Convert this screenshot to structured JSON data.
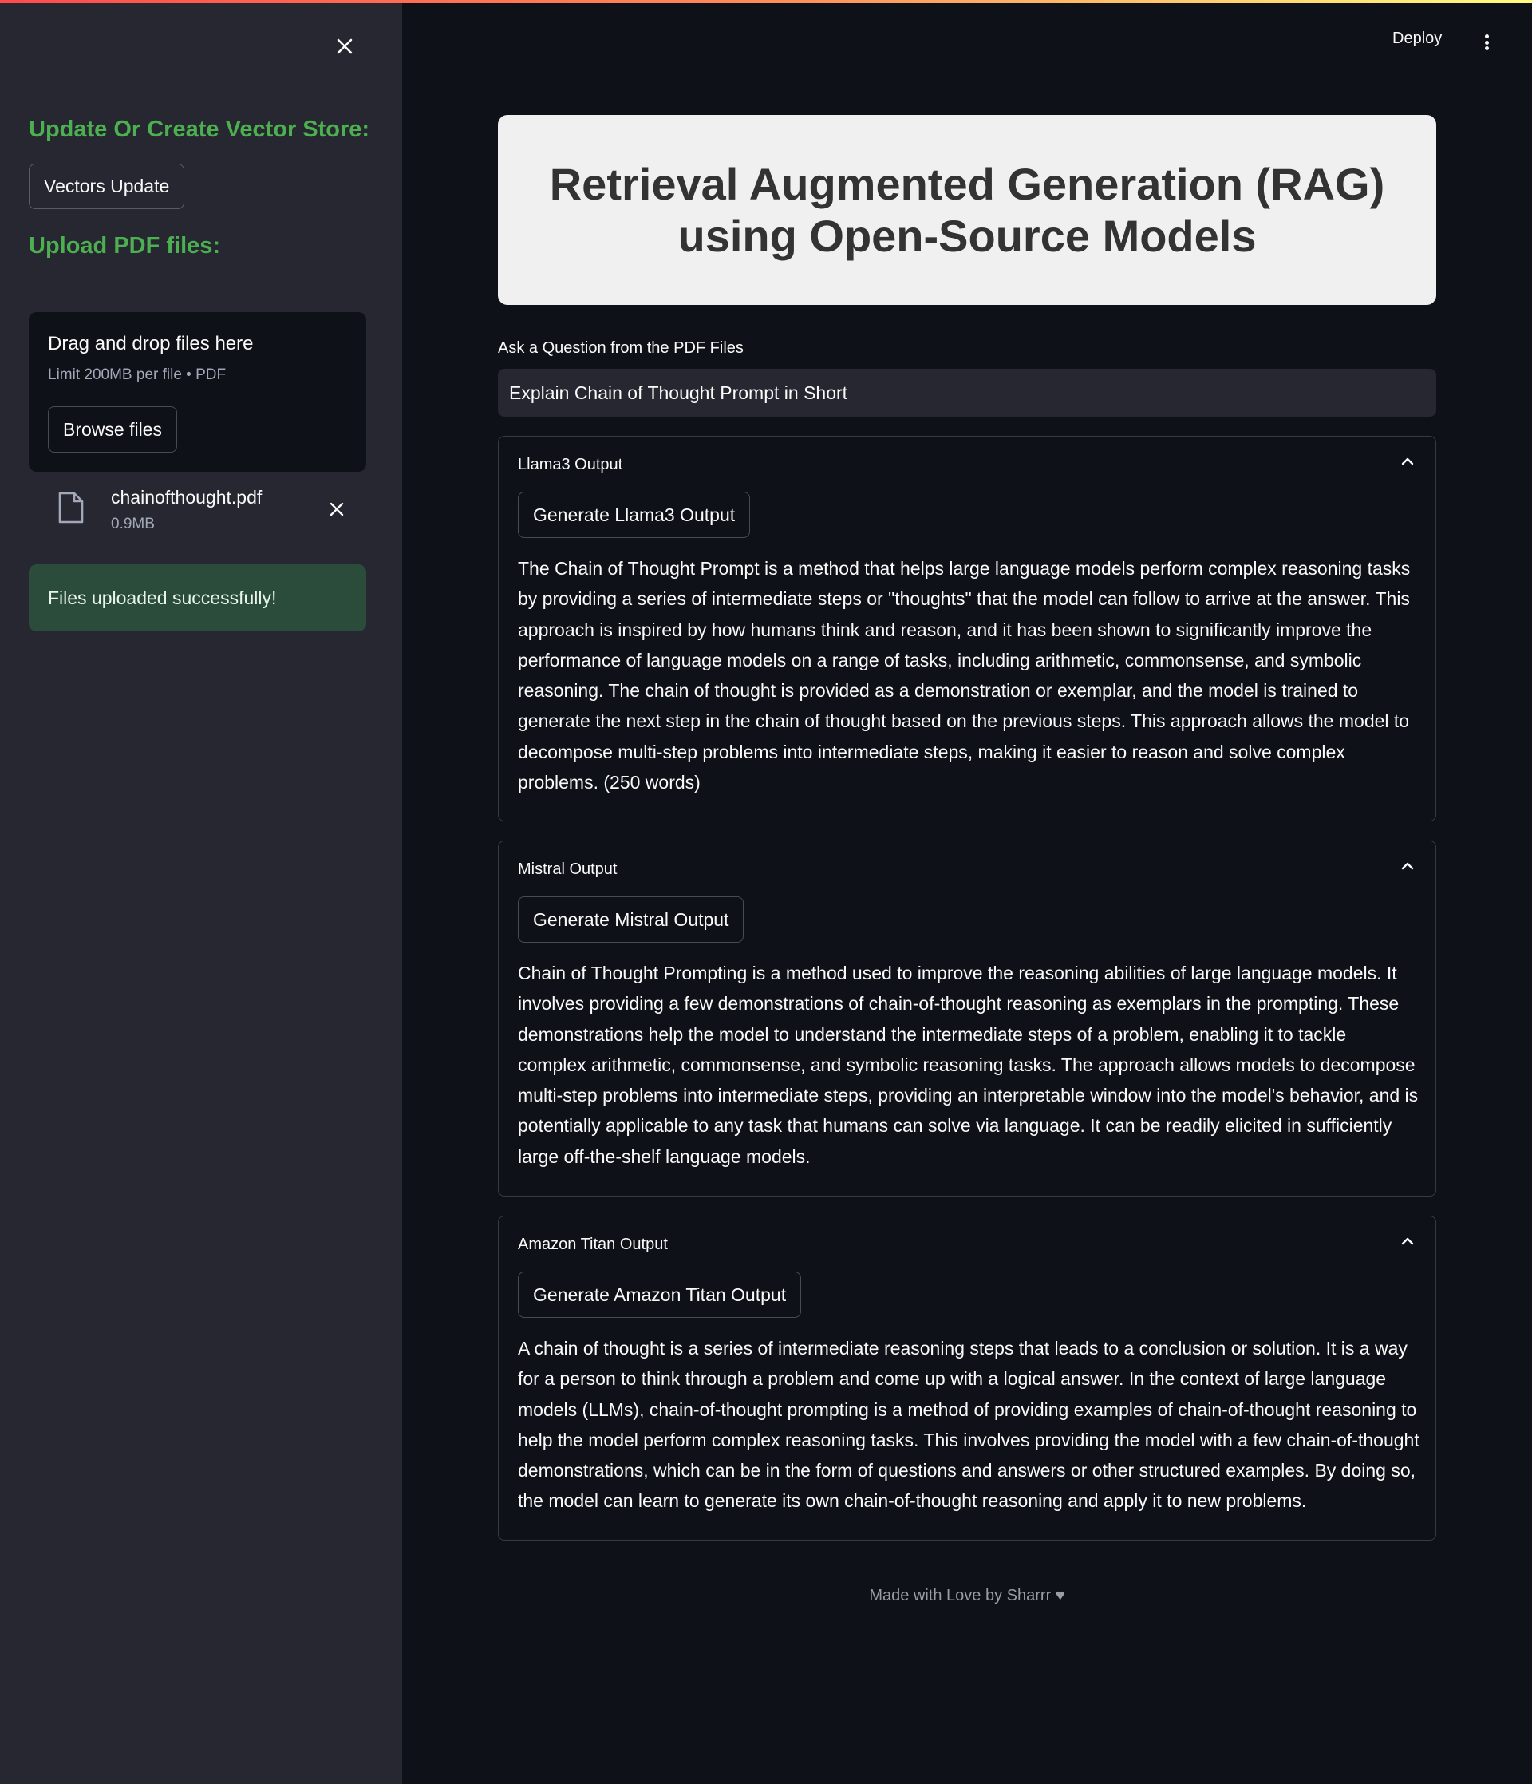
{
  "sidebar": {
    "vector_heading": "Update Or Create Vector Store:",
    "vectors_button": "Vectors Update",
    "upload_heading": "Upload PDF files:",
    "dropzone": {
      "title": "Drag and drop files here",
      "subtitle": "Limit 200MB per file • PDF",
      "browse_button": "Browse files"
    },
    "file": {
      "name": "chainofthought.pdf",
      "size": "0.9MB"
    },
    "success_message": "Files uploaded successfully!"
  },
  "header": {
    "deploy_label": "Deploy"
  },
  "main": {
    "title": "Retrieval Augmented Generation (RAG) using Open-Source Models",
    "question_label": "Ask a Question from the PDF Files",
    "question_value": "Explain Chain of Thought Prompt in Short",
    "expanders": [
      {
        "title": "Llama3 Output",
        "button": "Generate Llama3 Output",
        "text": "The Chain of Thought Prompt is a method that helps large language models perform complex reasoning tasks by providing a series of intermediate steps or \"thoughts\" that the model can follow to arrive at the answer. This approach is inspired by how humans think and reason, and it has been shown to significantly improve the performance of language models on a range of tasks, including arithmetic, commonsense, and symbolic reasoning. The chain of thought is provided as a demonstration or exemplar, and the model is trained to generate the next step in the chain of thought based on the previous steps. This approach allows the model to decompose multi-step problems into intermediate steps, making it easier to reason and solve complex problems. (250 words)"
      },
      {
        "title": "Mistral Output",
        "button": "Generate Mistral Output",
        "text": "Chain of Thought Prompting is a method used to improve the reasoning abilities of large language models. It involves providing a few demonstrations of chain-of-thought reasoning as exemplars in the prompting. These demonstrations help the model to understand the intermediate steps of a problem, enabling it to tackle complex arithmetic, commonsense, and symbolic reasoning tasks. The approach allows models to decompose multi-step problems into intermediate steps, providing an interpretable window into the model's behavior, and is potentially applicable to any task that humans can solve via language. It can be readily elicited in sufficiently large off-the-shelf language models."
      },
      {
        "title": "Amazon Titan Output",
        "button": "Generate Amazon Titan Output",
        "text": "A chain of thought is a series of intermediate reasoning steps that leads to a conclusion or solution. It is a way for a person to think through a problem and come up with a logical answer. In the context of large language models (LLMs), chain-of-thought prompting is a method of providing examples of chain-of-thought reasoning to help the model perform complex reasoning tasks. This involves providing the model with a few chain-of-thought demonstrations, which can be in the form of questions and answers or other structured examples. By doing so, the model can learn to generate its own chain-of-thought reasoning and apply it to new problems."
      }
    ],
    "footer": "Made with Love by Sharrr ♥"
  },
  "colors": {
    "background": "#0e1117",
    "sidebar": "#262730",
    "heading_green": "#4caf50",
    "success_bg": "#2b4c3a",
    "title_box": "#f0f0f0"
  },
  "icons": [
    "close-icon",
    "file-icon",
    "chevron-up-icon",
    "kebab-menu-icon"
  ]
}
